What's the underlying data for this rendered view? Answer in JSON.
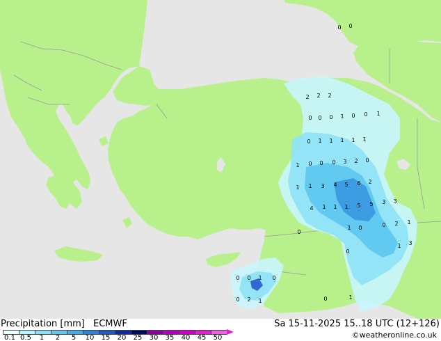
{
  "header": {
    "product": "Precipitation [mm]",
    "model": "ECMWF",
    "valid_time": "Sa 15-11-2025 15..18 UTC (12+126)",
    "credit": "©weatheronline.co.uk"
  },
  "legend": {
    "colors": [
      "#eaffff",
      "#b8f4ff",
      "#8ce0f5",
      "#64c8ee",
      "#46aaea",
      "#3282dc",
      "#2058c8",
      "#102a9c",
      "#000a5a",
      "#8c00a0",
      "#b400c0",
      "#d000cc",
      "#e020d0",
      "#f060e0"
    ],
    "tick_labels": [
      "0.1",
      "0.5",
      "1",
      "2",
      "5",
      "10",
      "15",
      "20",
      "25",
      "30",
      "35",
      "40",
      "45",
      "50"
    ]
  },
  "map": {
    "colors": {
      "sea": "#e6e6e6",
      "land": "#b8f08c",
      "border": "#9a9a9a",
      "coast": "#808080",
      "rain_light": "#c8f5ff",
      "rain_mid": "#8ee2f7",
      "rain_strong": "#5cc6ef",
      "rain_heavy": "#3a96e0",
      "rain_extreme": "#2a60d0"
    },
    "point_labels": [
      "0",
      "0",
      "2",
      "2",
      "2",
      "0",
      "0",
      "0",
      "1",
      "0",
      "0",
      "1",
      "0",
      "1",
      "1",
      "1",
      "1",
      "1",
      "1",
      "0",
      "0",
      "0",
      "3",
      "2",
      "0",
      "1",
      "1",
      "3",
      "4",
      "5",
      "6",
      "2",
      "4",
      "1",
      "1",
      "1",
      "5",
      "5",
      "3",
      "3",
      "1",
      "0",
      "0",
      "2",
      "1",
      "1",
      "3",
      "0",
      "0",
      "0",
      "0",
      "1",
      "0",
      "0",
      "2",
      "1",
      "1",
      "0"
    ]
  }
}
